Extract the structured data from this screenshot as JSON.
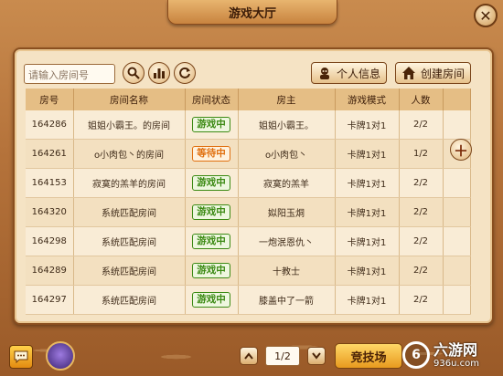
{
  "window": {
    "title": "游戏大厅"
  },
  "toolbar": {
    "search_placeholder": "请输入房间号",
    "personal_info_label": "个人信息",
    "create_room_label": "创建房间"
  },
  "table": {
    "columns": [
      "房号",
      "房间名称",
      "房间状态",
      "房主",
      "游戏模式",
      "人数"
    ],
    "rows": [
      {
        "id": "164286",
        "name": "姐姐小霸王。的房间",
        "status": "游戏中",
        "status_kind": "playing",
        "owner": "姐姐小霸王。",
        "mode": "卡牌1对1",
        "count": "2/2"
      },
      {
        "id": "164261",
        "name": "o小肉包丶的房间",
        "status": "等待中",
        "status_kind": "waiting",
        "owner": "o小肉包丶",
        "mode": "卡牌1对1",
        "count": "1/2"
      },
      {
        "id": "164153",
        "name": "寂寞的羔羊的房间",
        "status": "游戏中",
        "status_kind": "playing",
        "owner": "寂寞的羔羊",
        "mode": "卡牌1对1",
        "count": "2/2"
      },
      {
        "id": "164320",
        "name": "系统匹配房间",
        "status": "游戏中",
        "status_kind": "playing",
        "owner": "姒阳玉烔",
        "mode": "卡牌1对1",
        "count": "2/2"
      },
      {
        "id": "164298",
        "name": "系统匹配房间",
        "status": "游戏中",
        "status_kind": "playing",
        "owner": "一炮泯恩仇丶",
        "mode": "卡牌1对1",
        "count": "2/2"
      },
      {
        "id": "164289",
        "name": "系统匹配房间",
        "status": "游戏中",
        "status_kind": "playing",
        "owner": "十教士",
        "mode": "卡牌1对1",
        "count": "2/2"
      },
      {
        "id": "164297",
        "name": "系统匹配房间",
        "status": "游戏中",
        "status_kind": "playing",
        "owner": "膝盖中了一箭",
        "mode": "卡牌1对1",
        "count": "2/2"
      }
    ]
  },
  "pager": {
    "page": "1/2"
  },
  "arena_label": "竞技场",
  "watermark": {
    "name": "六游网",
    "url": "936u.com"
  },
  "colors": {
    "playing": "#3c8a14",
    "waiting": "#e07010",
    "accent": "#e89a1e"
  }
}
